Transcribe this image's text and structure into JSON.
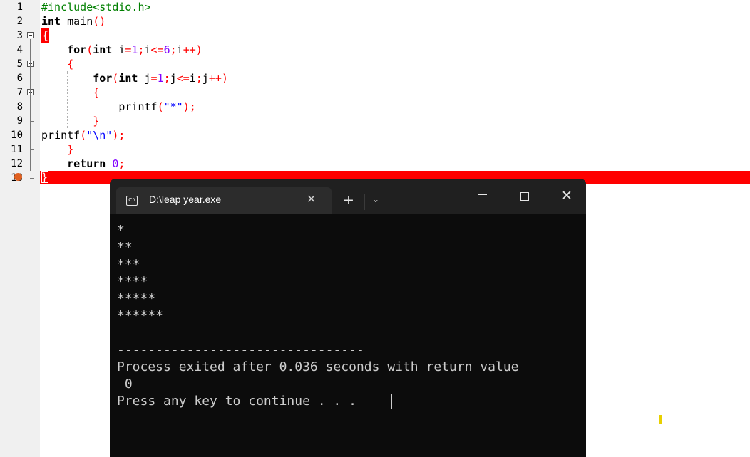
{
  "editor": {
    "line_numbers": [
      "1",
      "2",
      "3",
      "4",
      "5",
      "6",
      "7",
      "8",
      "9",
      "10",
      "11",
      "12",
      "13"
    ],
    "lines": [
      [
        {
          "t": "#include<stdio.h>",
          "c": "cm"
        }
      ],
      [
        {
          "t": "int",
          "c": "kw"
        },
        {
          "t": " main"
        },
        {
          "t": "()",
          "c": "sy"
        }
      ],
      [],
      [
        {
          "t": "    "
        },
        {
          "t": "for",
          "c": "kw"
        },
        {
          "t": "(",
          "c": "sy"
        },
        {
          "t": "int",
          "c": "kw"
        },
        {
          "t": " i"
        },
        {
          "t": "=",
          "c": "sy"
        },
        {
          "t": "1",
          "c": "nm"
        },
        {
          "t": ";",
          "c": "sy"
        },
        {
          "t": "i"
        },
        {
          "t": "<=",
          "c": "sy"
        },
        {
          "t": "6",
          "c": "nm"
        },
        {
          "t": ";",
          "c": "sy"
        },
        {
          "t": "i"
        },
        {
          "t": "++)",
          "c": "sy"
        }
      ],
      [
        {
          "t": "    "
        },
        {
          "t": "{",
          "c": "sy"
        }
      ],
      [
        {
          "t": "        "
        },
        {
          "t": "for",
          "c": "kw"
        },
        {
          "t": "(",
          "c": "sy"
        },
        {
          "t": "int",
          "c": "kw"
        },
        {
          "t": " j"
        },
        {
          "t": "=",
          "c": "sy"
        },
        {
          "t": "1",
          "c": "nm"
        },
        {
          "t": ";",
          "c": "sy"
        },
        {
          "t": "j"
        },
        {
          "t": "<=",
          "c": "sy"
        },
        {
          "t": "i"
        },
        {
          "t": ";",
          "c": "sy"
        },
        {
          "t": "j"
        },
        {
          "t": "++)",
          "c": "sy"
        }
      ],
      [
        {
          "t": "        "
        },
        {
          "t": "{",
          "c": "sy"
        }
      ],
      [
        {
          "t": "            printf"
        },
        {
          "t": "(",
          "c": "sy"
        },
        {
          "t": "\"*\"",
          "c": "st"
        },
        {
          "t": ");",
          "c": "sy"
        }
      ],
      [
        {
          "t": "        "
        },
        {
          "t": "}",
          "c": "sy"
        }
      ],
      [
        {
          "t": "printf"
        },
        {
          "t": "(",
          "c": "sy"
        },
        {
          "t": "\"\\n\"",
          "c": "st"
        },
        {
          "t": ");",
          "c": "sy"
        }
      ],
      [
        {
          "t": "    "
        },
        {
          "t": "}",
          "c": "sy"
        }
      ],
      [
        {
          "t": "    "
        },
        {
          "t": "return",
          "c": "kw"
        },
        {
          "t": " "
        },
        {
          "t": "0",
          "c": "nm"
        },
        {
          "t": ";",
          "c": "sy"
        }
      ],
      []
    ],
    "open_brace": "{",
    "close_brace": "}",
    "error_line_color": "#ff0000"
  },
  "console": {
    "tab_icon_label": "C:\\",
    "tab_icon": "cmd-icon",
    "tab_title": "D:\\leap year.exe",
    "tab_close": "✕",
    "new_tab": "+",
    "dropdown": "⌄",
    "close": "✕",
    "output": [
      "*",
      "**",
      "***",
      "****",
      "*****",
      "******",
      "",
      "--------------------------------",
      "Process exited after 0.036 seconds with return value",
      " 0",
      "Press any key to continue . . ."
    ],
    "background": "#0c0c0c",
    "text_color": "#cccccc"
  }
}
